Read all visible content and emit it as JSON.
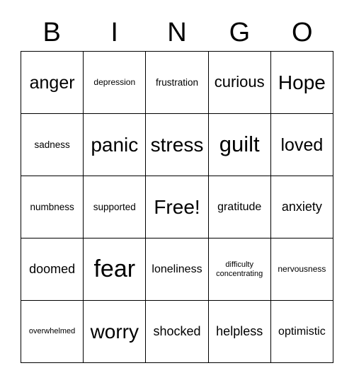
{
  "card": {
    "title": "BINGO",
    "header_letters": [
      "B",
      "I",
      "N",
      "G",
      "O"
    ],
    "free_space_label": "Free!",
    "colors": {
      "background": "#ffffff",
      "grid_line": "#000000",
      "text": "#000000"
    },
    "grid": {
      "rows": 5,
      "columns": 5
    },
    "cells": [
      {
        "text": "anger",
        "size": "fs-xl"
      },
      {
        "text": "depression",
        "size": "fs-s"
      },
      {
        "text": "frustration",
        "size": "fs-sm"
      },
      {
        "text": "curious",
        "size": "fs-l"
      },
      {
        "text": "Hope",
        "size": "fs-xxl"
      },
      {
        "text": "sadness",
        "size": "fs-sm"
      },
      {
        "text": "panic",
        "size": "fs-xxl"
      },
      {
        "text": "stress",
        "size": "fs-xxl"
      },
      {
        "text": "guilt",
        "size": "fs-huge"
      },
      {
        "text": "loved",
        "size": "fs-xl"
      },
      {
        "text": "numbness",
        "size": "fs-sm"
      },
      {
        "text": "supported",
        "size": "fs-sm"
      },
      {
        "text": "Free!",
        "size": "fs-xxl"
      },
      {
        "text": "gratitude",
        "size": "fs-m"
      },
      {
        "text": "anxiety",
        "size": "fs-ml"
      },
      {
        "text": "doomed",
        "size": "fs-ml"
      },
      {
        "text": "fear",
        "size": "fs-mega"
      },
      {
        "text": "loneliness",
        "size": "fs-m"
      },
      {
        "text": "difficulty\nconcentrating",
        "size": "fs-xs"
      },
      {
        "text": "nervousness",
        "size": "fs-s"
      },
      {
        "text": "overwhelmed",
        "size": "fs-xs"
      },
      {
        "text": "worry",
        "size": "fs-xxl"
      },
      {
        "text": "shocked",
        "size": "fs-ml"
      },
      {
        "text": "helpless",
        "size": "fs-ml"
      },
      {
        "text": "optimistic",
        "size": "fs-m"
      }
    ]
  }
}
